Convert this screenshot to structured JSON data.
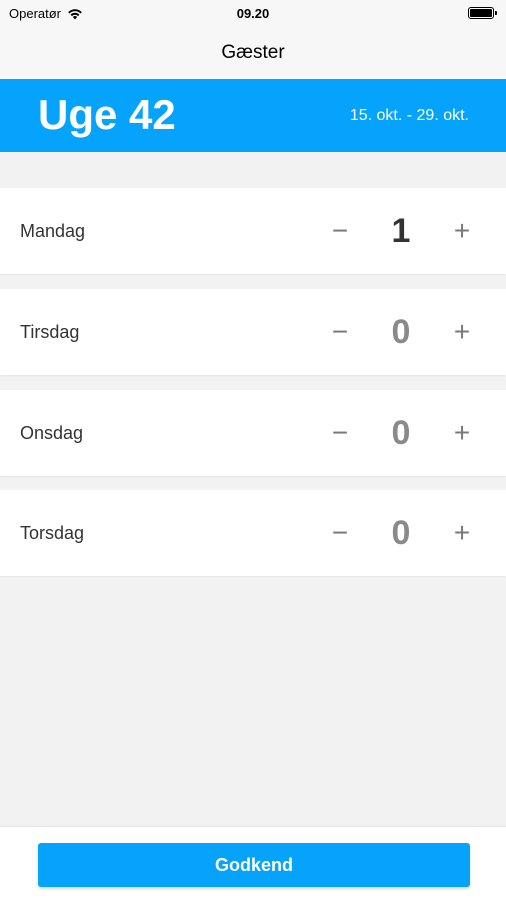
{
  "status_bar": {
    "carrier": "Operatør",
    "time": "09.20",
    "icons": [
      "wifi-icon",
      "battery-icon"
    ]
  },
  "nav": {
    "title": "Gæster"
  },
  "week": {
    "title": "Uge 42",
    "range": "15. okt. - 29. okt."
  },
  "days": [
    {
      "label": "Mandag",
      "count": "1",
      "minus": "−",
      "plus": "+"
    },
    {
      "label": "Tirsdag",
      "count": "0",
      "minus": "−",
      "plus": "+"
    },
    {
      "label": "Onsdag",
      "count": "0",
      "minus": "−",
      "plus": "+"
    },
    {
      "label": "Torsdag",
      "count": "0",
      "minus": "−",
      "plus": "+"
    }
  ],
  "footer": {
    "approve_label": "Godkend"
  },
  "colors": {
    "accent": "#06a3fc",
    "count_active": "#333333",
    "count_zero": "#8a8a8a"
  }
}
